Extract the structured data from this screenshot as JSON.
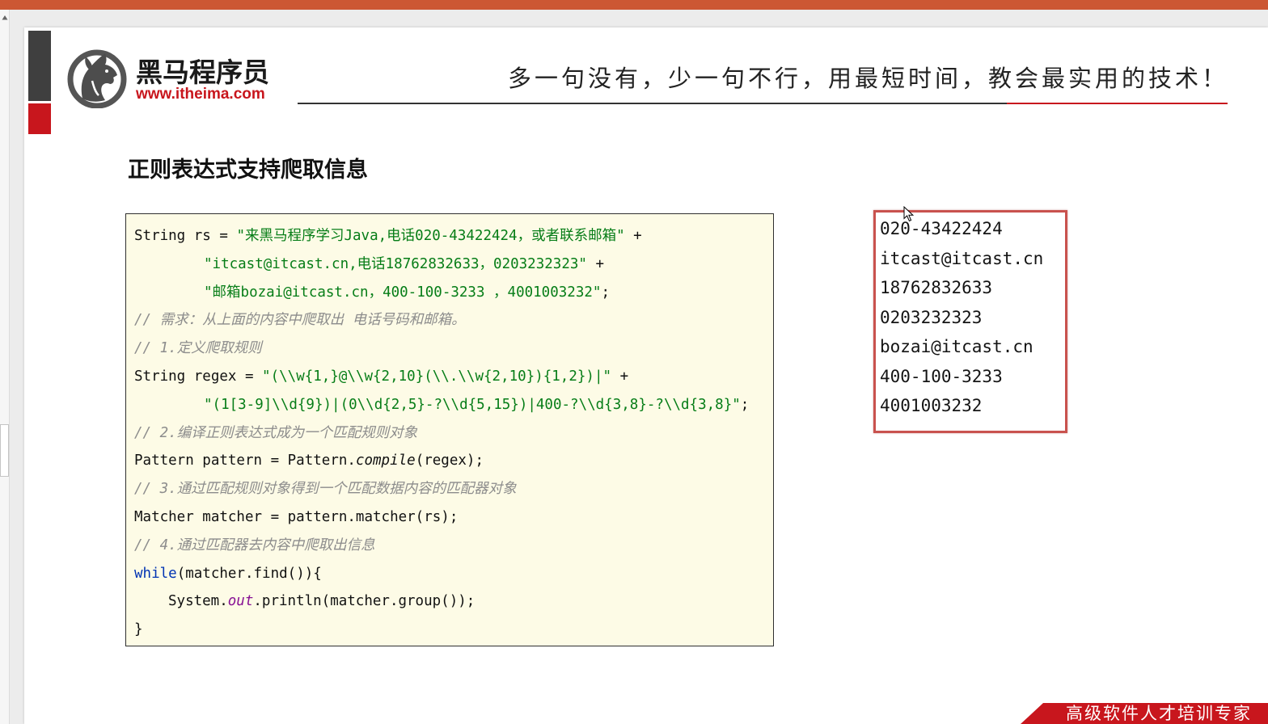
{
  "colors": {
    "titlebar": "#cc5733",
    "brand_red": "#c8161d",
    "code_bg": "#fdfbe6",
    "code_string": "#067d17",
    "code_comment": "#8c8c8c",
    "code_keyword": "#0033b3",
    "code_field": "#871094",
    "output_border": "#c9524e"
  },
  "icons": {
    "logo": "horse-head-logo-icon",
    "cursor": "mouse-cursor-icon",
    "scroll_up": "scroll-up-arrow-icon"
  },
  "header": {
    "brand_name": "黑马程序员",
    "brand_url": "www.itheima.com",
    "slogan": "多一句没有，少一句不行，用最短时间，教会最实用的技术！"
  },
  "title": "正则表达式支持爬取信息",
  "code_lines": [
    [
      "String rs = ",
      "\"来黑马程序学习Java,电话020-43422424，或者联系邮箱\"",
      " +"
    ],
    [
      "\"itcast@itcast.cn,电话18762832633，0203232323\"",
      " +"
    ],
    [
      "\"邮箱bozai@itcast.cn，400-100-3233 ，4001003232\"",
      ";"
    ],
    [
      "// 需求：从上面的内容中爬取出 电话号码和邮箱。"
    ],
    [
      "// 1.定义爬取规则"
    ],
    [
      "String regex = ",
      "\"(\\\\w{1,}@\\\\w{2,10}(\\\\.\\\\w{2,10}){1,2})|\"",
      " +"
    ],
    [
      "\"(1[3-9]\\\\d{9})|(0\\\\d{2,5}-?\\\\d{5,15})|400-?\\\\d{3,8}-?\\\\d{3,8}\"",
      ";"
    ],
    [
      "// 2.编译正则表达式成为一个匹配规则对象"
    ],
    [
      "Pattern pattern = Pattern.",
      "compile",
      "(regex);"
    ],
    [
      "// 3.通过匹配规则对象得到一个匹配数据内容的匹配器对象"
    ],
    [
      "Matcher matcher = pattern.matcher(rs);"
    ],
    [
      "// 4.通过匹配器去内容中爬取出信息"
    ],
    [
      "while",
      "(matcher.find()){"
    ],
    [
      "System.",
      "out",
      ".println(matcher.group());"
    ],
    [
      "}"
    ]
  ],
  "output_lines": [
    "020-43422424",
    "itcast@itcast.cn",
    "18762832633",
    "0203232323",
    "bozai@itcast.cn",
    "400-100-3233",
    "4001003232"
  ],
  "footer_banner": "高级软件人才培训专家"
}
